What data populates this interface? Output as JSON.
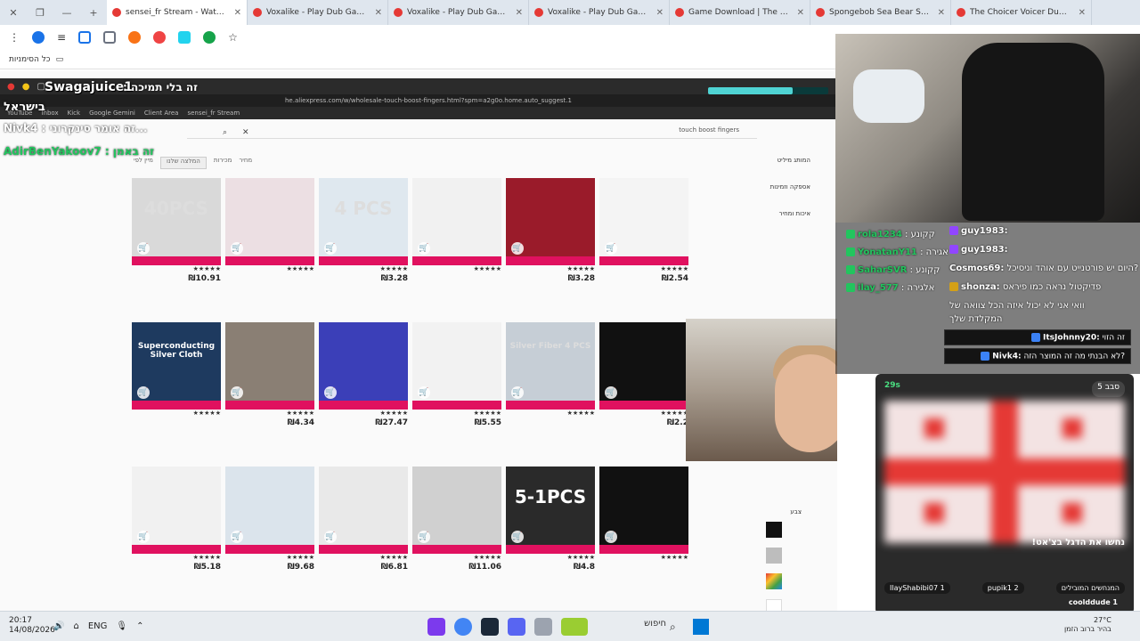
{
  "browser": {
    "tabs": [
      {
        "label": "sensei_fr Stream - Watch Li",
        "active": true
      },
      {
        "label": "Voxalike - Play Dub Game O",
        "active": false
      },
      {
        "label": "Voxalike - Play Dub Game O",
        "active": false
      },
      {
        "label": "Voxalike - Play Dub Game Onli",
        "active": false
      },
      {
        "label": "Game Download | The Choicer",
        "active": false
      },
      {
        "label": "Spongebob Sea Bear Scene Dub",
        "active": false
      },
      {
        "label": "The Choicer Voicer Dub Packs |",
        "active": false
      }
    ],
    "bookmarks_label": "כל הסימניות"
  },
  "stream": {
    "overlay_username": "Swagajuice1",
    "overlay_message": ": זה בלי תמיכה",
    "israel_label": "בישראל",
    "ghost_chat_1": "Nivk4 : זה אומר סינקרוני...",
    "ghost_chat_2": "AdirBenYakoov7 : זה באמן",
    "progress_fraction": 0.7,
    "url": "he.aliexpress.com/w/wholesale-touch-boost-fingers.html?spm=a2g0o.home.auto_suggest.1",
    "search_query": "touch boost fingers",
    "filters": [
      "מיין לפי",
      "המלצה שלנו",
      "מכירות",
      "מחיר"
    ],
    "sidebar_sections": [
      "המותג מיליט",
      "אספקה וזמינות",
      "איכות ומחיר"
    ],
    "color_label": "צבע",
    "products": [
      {
        "price": "₪10.91",
        "label": "40PCS",
        "thumb": "#d9d9d9"
      },
      {
        "price": "",
        "label": "",
        "thumb": "#ecdfe3"
      },
      {
        "price": "₪3.28",
        "label": "4 PCS",
        "thumb": "#dfe8ef"
      },
      {
        "price": "",
        "label": "",
        "thumb": "#f1f1f1"
      },
      {
        "price": "₪3.28",
        "label": "",
        "thumb": "#9a1b2a"
      },
      {
        "price": "₪2.54",
        "label": "",
        "thumb": "#f4f4f4"
      },
      {
        "price": "",
        "label": "Superconducting Silver Cloth",
        "thumb": "#1e3a5f"
      },
      {
        "price": "₪4.34",
        "label": "",
        "thumb": "#8a7f74"
      },
      {
        "price": "₪27.47",
        "label": "",
        "thumb": "#3b3fb8"
      },
      {
        "price": "₪5.55",
        "label": "",
        "thumb": "#f2f2f2"
      },
      {
        "price": "",
        "label": "Silver Fiber 4 PCS",
        "thumb": "#c6ced6"
      },
      {
        "price": "₪2.2",
        "label": "",
        "thumb": "#111111"
      },
      {
        "price": "₪5.18",
        "label": "",
        "thumb": "#f1f1f1"
      },
      {
        "price": "₪9.68",
        "label": "",
        "thumb": "#dbe4ec"
      },
      {
        "price": "₪6.81",
        "label": "",
        "thumb": "#e9e9e9"
      },
      {
        "price": "₪11.06",
        "label": "",
        "thumb": "#d0d0d0"
      },
      {
        "price": "₪4.8",
        "label": "5-1PCS",
        "thumb": "#2a2a2a"
      },
      {
        "price": "",
        "label": "",
        "thumb": "#111111"
      }
    ]
  },
  "chat": {
    "lines": [
      {
        "user": "guy1983:",
        "text": "",
        "badge": "purple"
      },
      {
        "user": "guy1983:",
        "text": "",
        "badge": "purple"
      },
      {
        "user": "Cosmos69:",
        "text": "היום יש פורטנייט עם אוהד וניסיכל?",
        "badge": ""
      },
      {
        "user": "shonza:",
        "text": "פדיקטול נראה כמו פיראס",
        "badge": "gold"
      },
      {
        "user": "",
        "text": "וואי אני לא יכול איזה הכל צוואה של",
        "badge": ""
      },
      {
        "user": "",
        "text": "המקלדת שלך",
        "badge": ""
      }
    ],
    "boxed": [
      {
        "user": "ItsJohnny20:",
        "text": "זה הזוי"
      },
      {
        "user": "Nivk4:",
        "text": "לא הבנתי מה זה המוצר הזה?"
      }
    ],
    "left_names": [
      {
        "user": "rola1234",
        "text": ": קקונע"
      },
      {
        "user": "YonatanY11",
        "text": ": אגירה"
      },
      {
        "user": "SaharSVR",
        "text": ": קקונע"
      },
      {
        "user": "ilay_577",
        "text": ": אלגירה"
      }
    ]
  },
  "game": {
    "round_label": "סבב 5",
    "timer": "29s",
    "guess_prompt": "!נחשו את הדגל בצ'אט",
    "players": [
      "IlayShabibi07 1",
      "pupik1 2",
      "המנחשים המובילים"
    ],
    "footer_user": "coolddude 1"
  },
  "taskbar": {
    "time": "20:17",
    "date": "14/08/2026",
    "lang": "ENG",
    "search": "חיפוש",
    "temp": "27°C",
    "weather_text": "בהיר ברוב הזמן"
  }
}
